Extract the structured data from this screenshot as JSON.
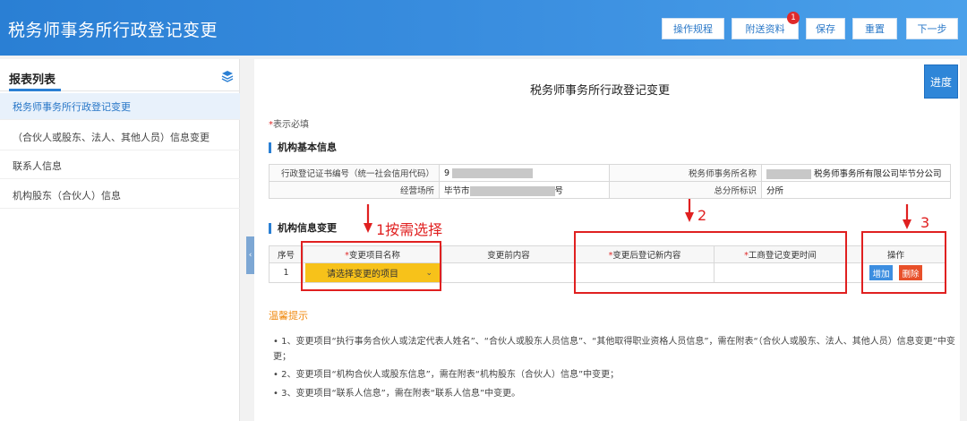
{
  "app": {
    "title": "税务师事务所行政登记变更"
  },
  "toolbar": {
    "buttons": [
      "操作规程",
      "附送资料",
      "保存",
      "重置",
      "下一步"
    ],
    "badge": "1"
  },
  "sidebar": {
    "title": "报表列表",
    "items": [
      "税务师事务所行政登记变更",
      "（合伙人或股东、法人、其他人员）信息变更",
      "联系人信息",
      "机构股东（合伙人）信息"
    ]
  },
  "main": {
    "progress_label": "进度",
    "form_title": "税务师事务所行政登记变更",
    "required_note": {
      "star": "*",
      "text": "表示必填"
    },
    "basic_info": {
      "section_title": "机构基本信息",
      "rows": [
        {
          "label1": "行政登记证书编号（统一社会信用代码）",
          "value1": "9",
          "label2": "税务师事务所名称",
          "value2": "税务师事务所有限公司毕节分公司"
        },
        {
          "label1": "经营场所",
          "value1_prefix": "毕节市",
          "value1_suffix": "号",
          "label2": "总分所标识",
          "value2": "分所"
        }
      ]
    },
    "change_info": {
      "section_title": "机构信息变更",
      "headers": [
        "序号",
        "变更项目名称",
        "变更前内容",
        "变更后登记新内容",
        "工商登记变更时间",
        "操作"
      ],
      "required_mark": "*",
      "row": {
        "index": "1",
        "select_placeholder": "请选择变更的项目",
        "before": "",
        "after": "",
        "time": "",
        "add_label": "增加",
        "delete_label": "删除"
      }
    },
    "annotations": [
      "1按需选择",
      "2",
      "3"
    ],
    "tips": {
      "title": "温馨提示",
      "items": [
        "1、变更项目“执行事务合伙人或法定代表人姓名”、“合伙人或股东人员信息”、“其他取得职业资格人员信息”，需在附表“（合伙人或股东、法人、其他人员）信息变更”中变更；",
        "2、变更项目“机构合伙人或股东信息”，需在附表“机构股东（合伙人）信息”中变更；",
        "3、变更项目“联系人信息”，需在附表“联系人信息”中变更。"
      ]
    }
  },
  "colors": {
    "header_blue": "#2a7fd4",
    "select_yellow": "#f7c21a",
    "annotation_red": "#e02020",
    "tips_orange": "#f08a10"
  }
}
